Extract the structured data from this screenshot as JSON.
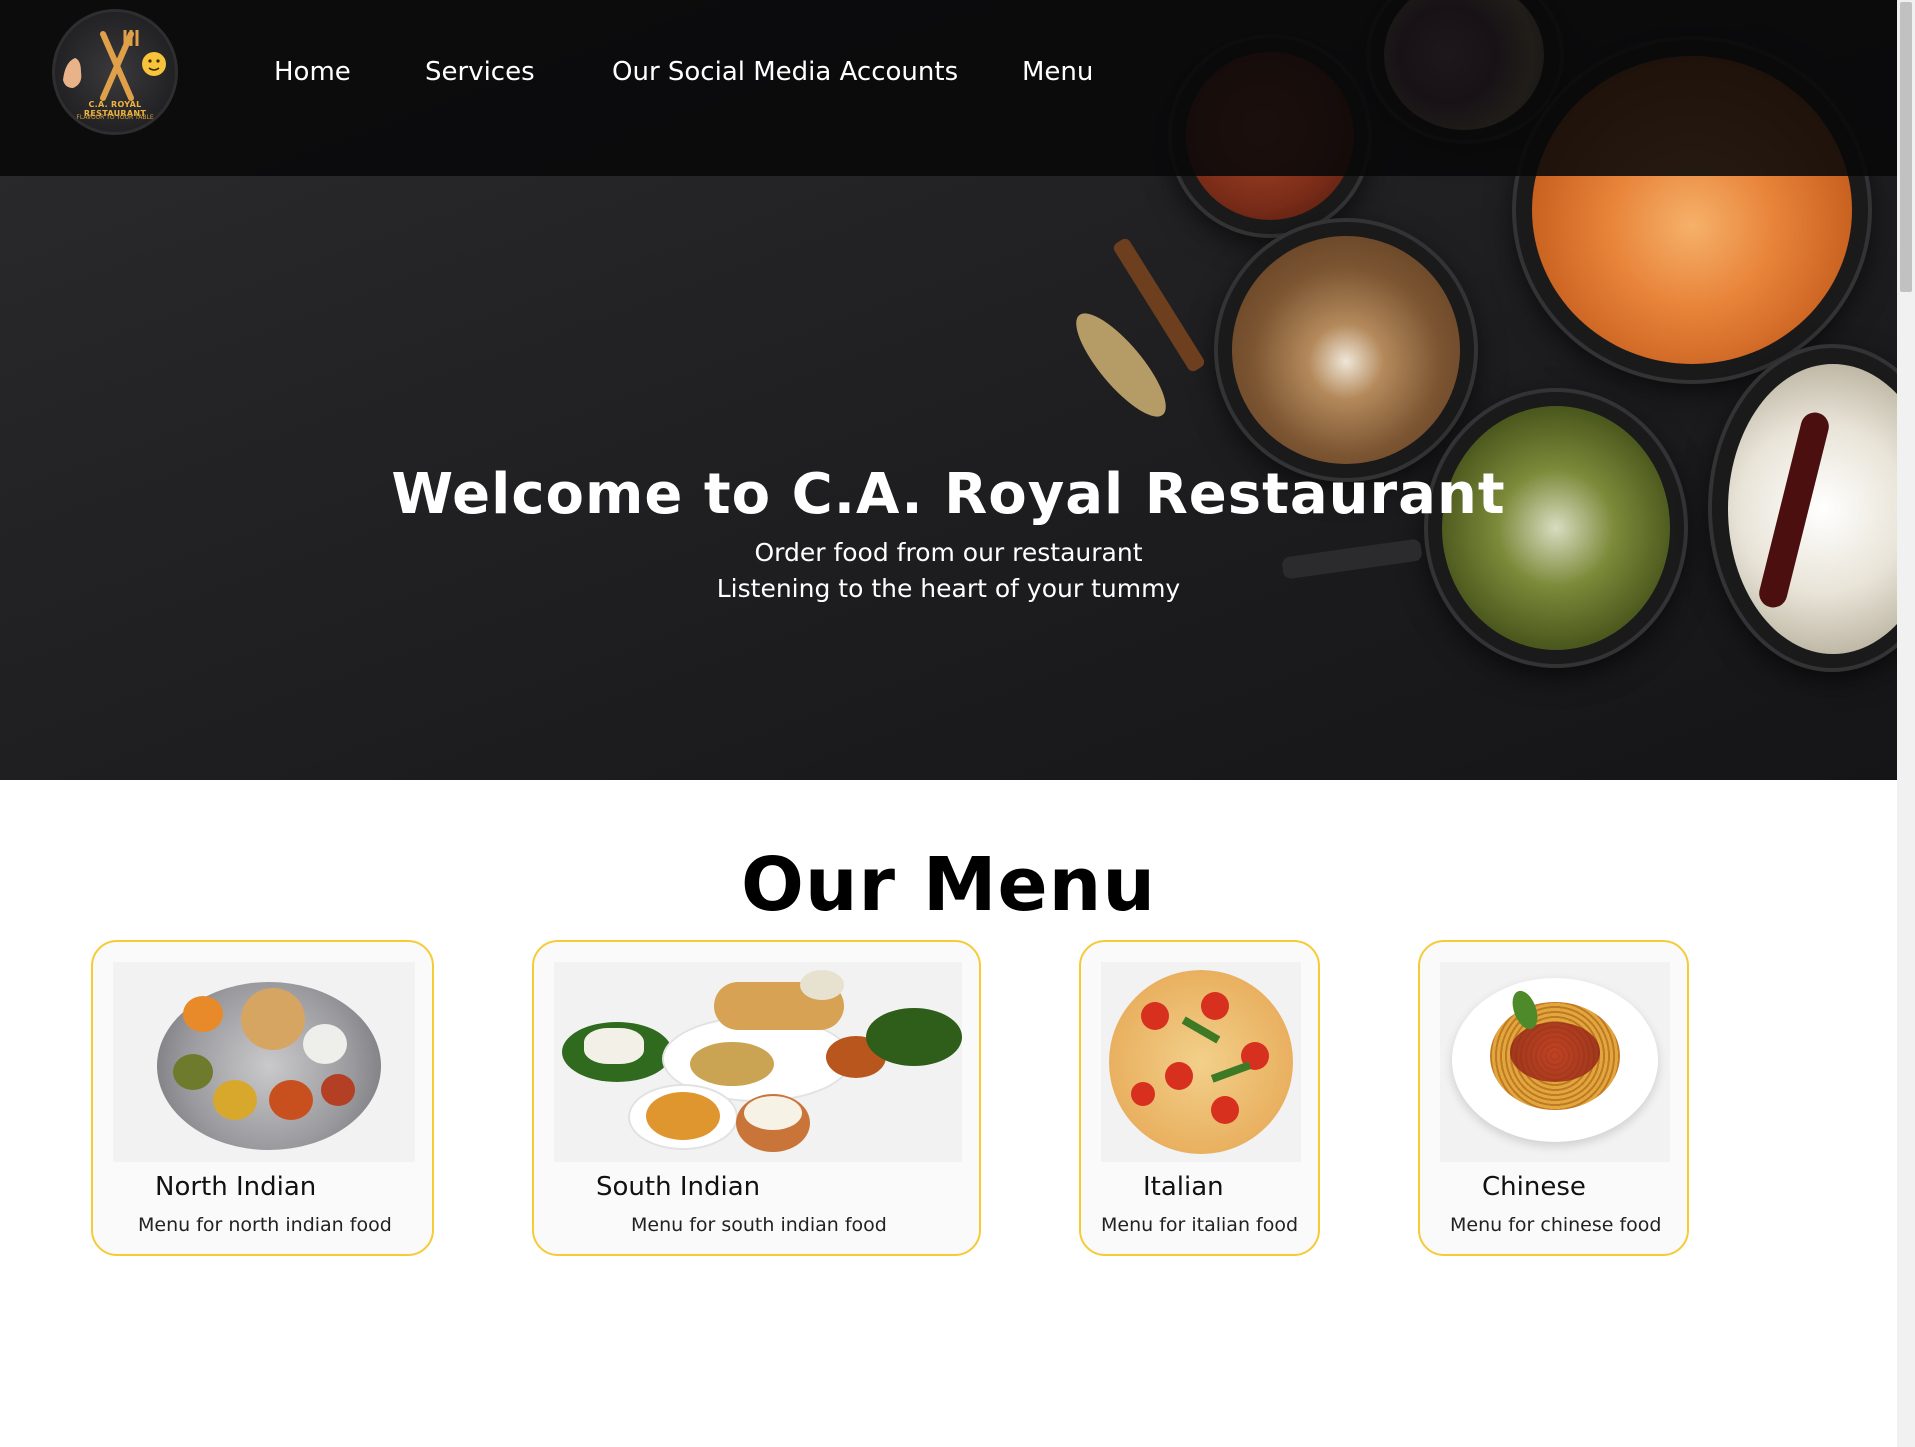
{
  "brand": {
    "logo_name": "C.A. ROYAL RESTAURANT",
    "logo_tagline": "FLAVOUR TO YOUR TABLE"
  },
  "nav": {
    "items": [
      {
        "label": "Home"
      },
      {
        "label": "Services"
      },
      {
        "label": "Our Social Media Accounts"
      },
      {
        "label": "Menu"
      }
    ]
  },
  "hero": {
    "title": "Welcome to C.A. Royal Restaurant",
    "subtitle_1": "Order food from our restaurant",
    "subtitle_2": "Listening to the heart of your tummy"
  },
  "menu_section": {
    "heading": "Our Menu",
    "cards": [
      {
        "title": "North Indian",
        "description": "Menu for north indian food"
      },
      {
        "title": "South Indian",
        "description": "Menu for south indian food"
      },
      {
        "title": "Italian",
        "description": "Menu for italian food"
      },
      {
        "title": "Chinese",
        "description": "Menu for chinese food"
      }
    ]
  },
  "colors": {
    "accent_border": "#f5cb38",
    "hero_bg": "#1f1f21",
    "navbar_bg": "#080809"
  }
}
